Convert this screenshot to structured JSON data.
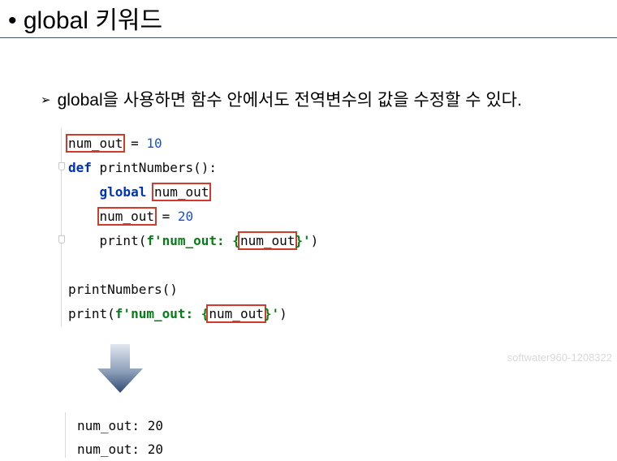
{
  "slide": {
    "title": "• global 키워드",
    "bullet_marker": "➢",
    "bullet_text": "global을 사용하면 함수 안에서도 전역변수의 값을 수정할 수 있다."
  },
  "code": {
    "l1_var": "num_out",
    "l1_assign": " = ",
    "l1_value": "10",
    "l2_keyword": "def",
    "l2_rest": " printNumbers():",
    "l3_indent": "    ",
    "l3_keyword": "global",
    "l3_space": " ",
    "l3_var": "num_out",
    "l4_indent": "    ",
    "l4_var": "num_out",
    "l4_assign": " = ",
    "l4_value": "20",
    "l5_indent": "    ",
    "l5_call": "print(",
    "l5_prefix": "f'num_out: ",
    "l5_brace_open": "{",
    "l5_var": "num_out",
    "l5_brace_close": "}",
    "l5_quote": "'",
    "l5_close": ")",
    "l7_call": "printNumbers()",
    "l8_call": "print(",
    "l8_prefix": "f'num_out: ",
    "l8_brace_open": "{",
    "l8_var": "num_out",
    "l8_brace_close": "}",
    "l8_quote": "'",
    "l8_close": ")"
  },
  "watermark": "softwater960-1208322",
  "output": {
    "lines": [
      "num_out: 20",
      "num_out: 20"
    ]
  },
  "colors": {
    "highlight_box": "#d23b2b",
    "keyword": "#0033b3",
    "number": "#1750eb",
    "fstring": "#067d17",
    "title_rule": "#44546a",
    "arrow_dark": "#2f4a74",
    "arrow_light": "#dfe6ef"
  },
  "icons": {
    "bullet": "arrow-bullet-icon",
    "flow": "down-arrow-icon"
  }
}
